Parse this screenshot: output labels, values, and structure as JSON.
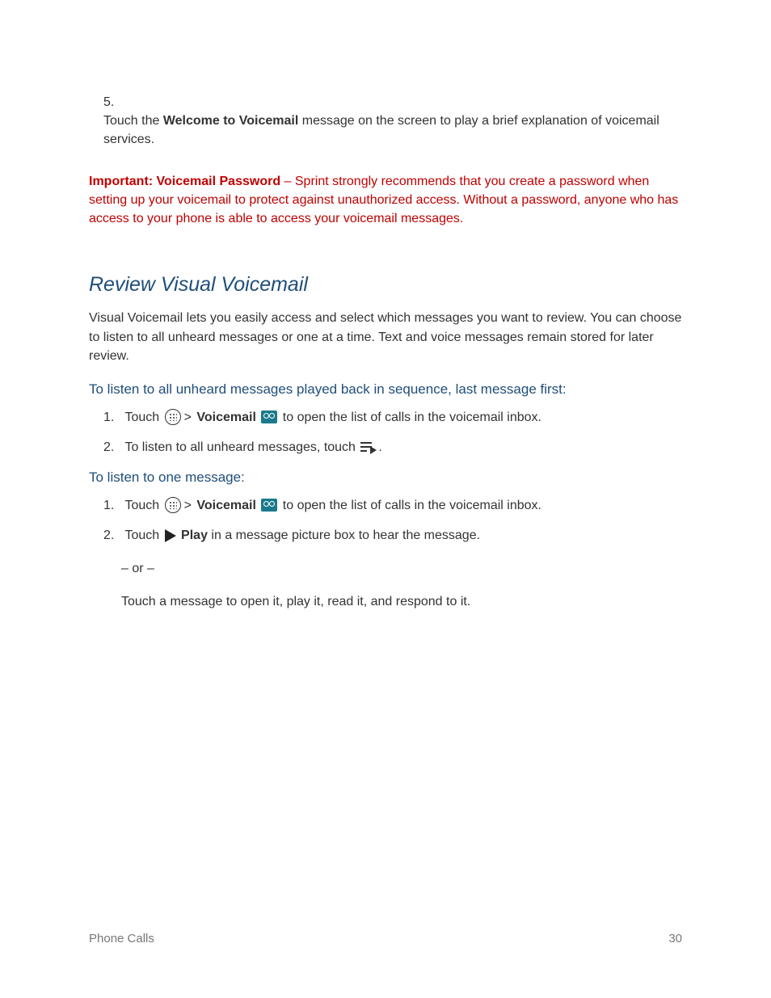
{
  "step5": {
    "number": "5.",
    "pre": "Touch the ",
    "bold": "Welcome to Voicemail",
    "post": " message on the screen to play a brief explanation of voicemail services."
  },
  "important": {
    "bold": "Important: Voicemail Password",
    "rest": " – Sprint strongly recommends that you create a password when setting up your voicemail to protect against unauthorized access. Without a password, anyone who has access to your phone is able to access your voicemail messages."
  },
  "section": {
    "title": "Review Visual Voicemail",
    "intro": "Visual Voicemail lets you easily access and select which messages you want to review. You can choose to listen to all unheard messages or one at a time. Text and voice messages remain stored for later review."
  },
  "sub1": {
    "heading": "To listen to all unheard messages played back in sequence, last message first:",
    "li1": {
      "num": "1.",
      "touch": "Touch ",
      "gt": ">",
      "vm_bold": "Voicemail",
      "rest": " to open the list of calls in the voicemail inbox."
    },
    "li2": {
      "num": "2.",
      "pre": "To listen to all unheard messages, touch ",
      "period": "."
    }
  },
  "sub2": {
    "heading": "To listen to one message:",
    "li1": {
      "num": "1.",
      "touch": "Touch ",
      "gt": ">",
      "vm_bold": "Voicemail",
      "rest": " to open the list of calls in the voicemail inbox."
    },
    "li2": {
      "num": "2.",
      "touch": "Touch ",
      "play_bold": "Play",
      "rest": " in a message picture box to hear the message."
    },
    "or": "– or –",
    "respond": "Touch a message to open it, play it, read it, and respond to it."
  },
  "footer": {
    "left": "Phone Calls",
    "right": "30"
  }
}
